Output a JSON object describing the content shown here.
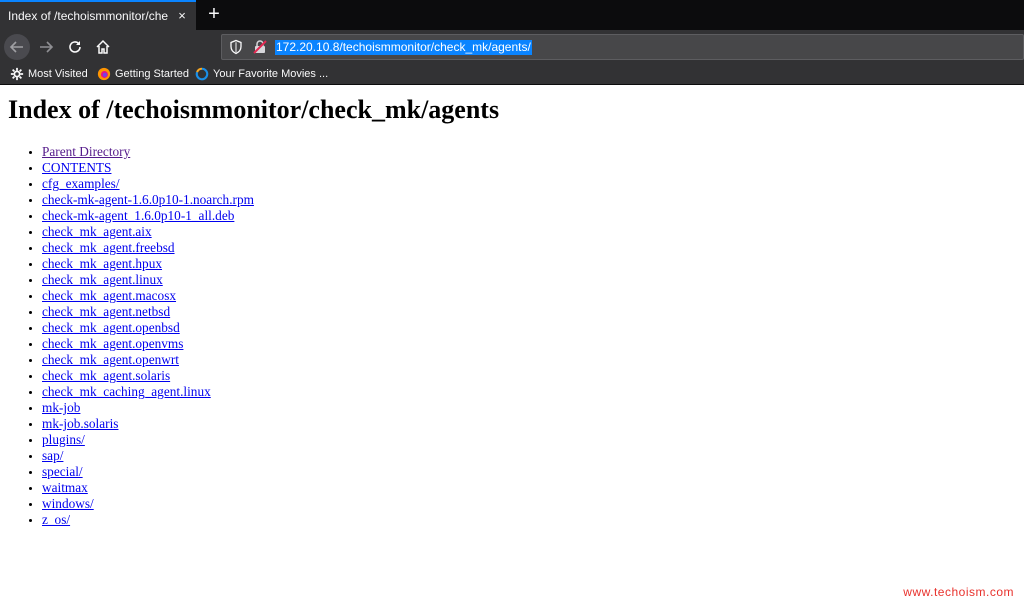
{
  "tab": {
    "title": "Index of /techoismmonitor/check_",
    "close_glyph": "×",
    "new_tab_glyph": "+"
  },
  "urlbar": {
    "url": "172.20.10.8/techoismmonitor/check_mk/agents/"
  },
  "bookmarks": [
    {
      "label": "Most Visited",
      "icon": "gear-icon"
    },
    {
      "label": "Getting Started",
      "icon": "firefox-icon"
    },
    {
      "label": "Your Favorite Movies ...",
      "icon": "site-icon"
    }
  ],
  "page": {
    "heading": "Index of /techoismmonitor/check_mk/agents",
    "entries": [
      "Parent Directory",
      "CONTENTS",
      "cfg_examples/",
      "check-mk-agent-1.6.0p10-1.noarch.rpm",
      "check-mk-agent_1.6.0p10-1_all.deb",
      "check_mk_agent.aix",
      "check_mk_agent.freebsd",
      "check_mk_agent.hpux",
      "check_mk_agent.linux",
      "check_mk_agent.macosx",
      "check_mk_agent.netbsd",
      "check_mk_agent.openbsd",
      "check_mk_agent.openvms",
      "check_mk_agent.openwrt",
      "check_mk_agent.solaris",
      "check_mk_caching_agent.linux",
      "mk-job",
      "mk-job.solaris",
      "plugins/",
      "sap/",
      "special/",
      "waitmax",
      "windows/",
      "z_os/"
    ]
  },
  "watermark": "www.techoism.com",
  "colors": {
    "link": "#0000ee",
    "visited_link": "#551a8b",
    "accent": "#0a84ff",
    "watermark": "#e8322d"
  }
}
